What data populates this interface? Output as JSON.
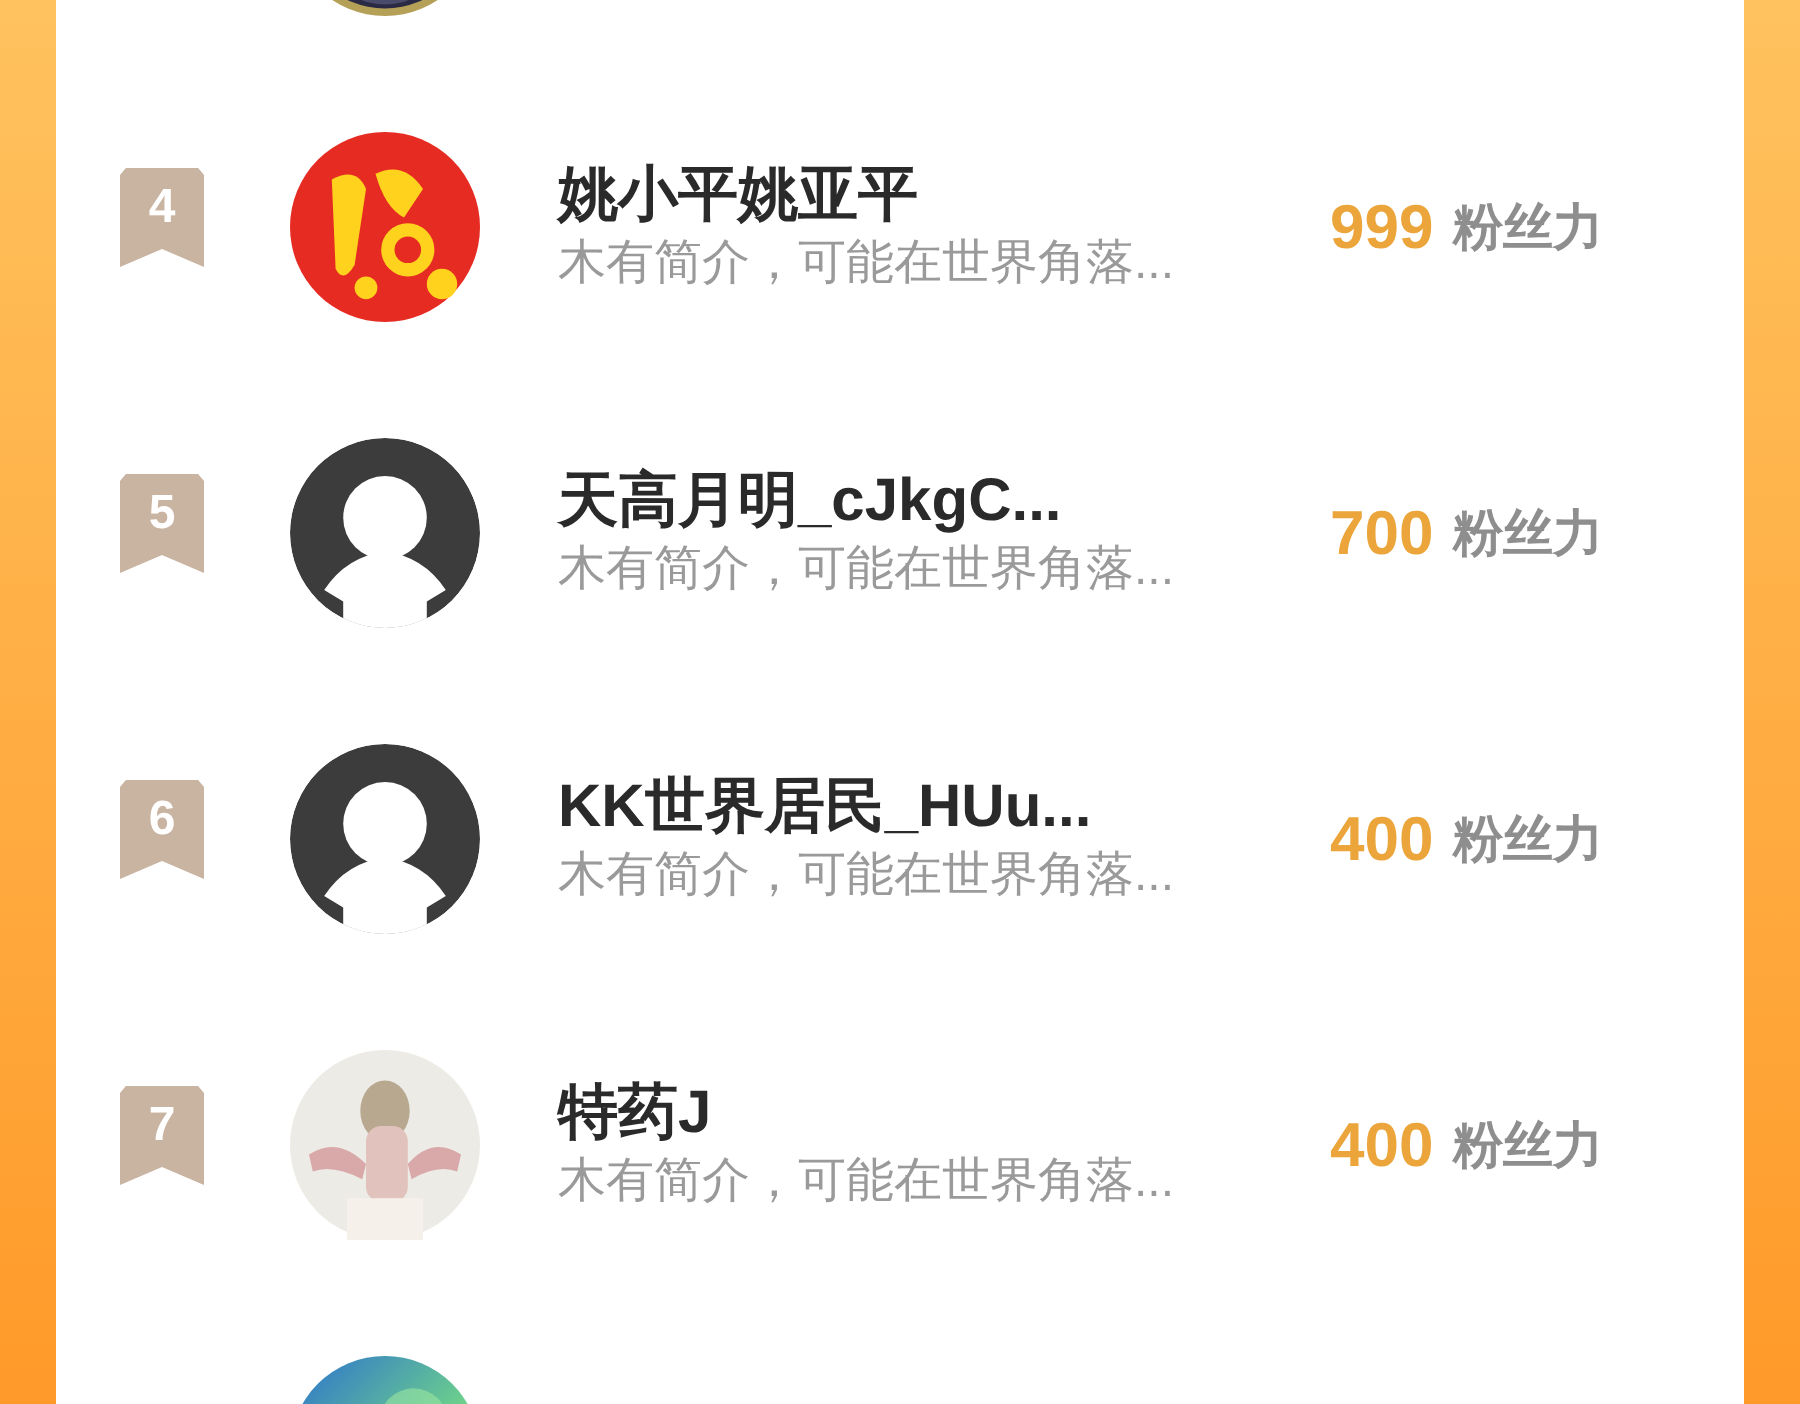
{
  "ranking": [
    {
      "avatar": {
        "kind": "picture"
      }
    },
    {
      "rank": "4",
      "name": "姚小平姚亚平",
      "description": "木有简介，可能在世界角落...",
      "score": "999",
      "score_unit": "粉丝力",
      "avatar": {
        "kind": "picture"
      }
    },
    {
      "rank": "5",
      "name": "天高月明_cJkgC...",
      "description": "木有简介，可能在世界角落...",
      "score": "700",
      "score_unit": "粉丝力",
      "avatar": {
        "kind": "default"
      }
    },
    {
      "rank": "6",
      "name": "KK世界居民_HUu...",
      "description": "木有简介，可能在世界角落...",
      "score": "400",
      "score_unit": "粉丝力",
      "avatar": {
        "kind": "default"
      }
    },
    {
      "rank": "7",
      "name": "特药J",
      "description": "木有简介，可能在世界角落...",
      "score": "400",
      "score_unit": "粉丝力",
      "avatar": {
        "kind": "picture"
      }
    },
    {
      "avatar": {
        "kind": "picture"
      }
    }
  ]
}
